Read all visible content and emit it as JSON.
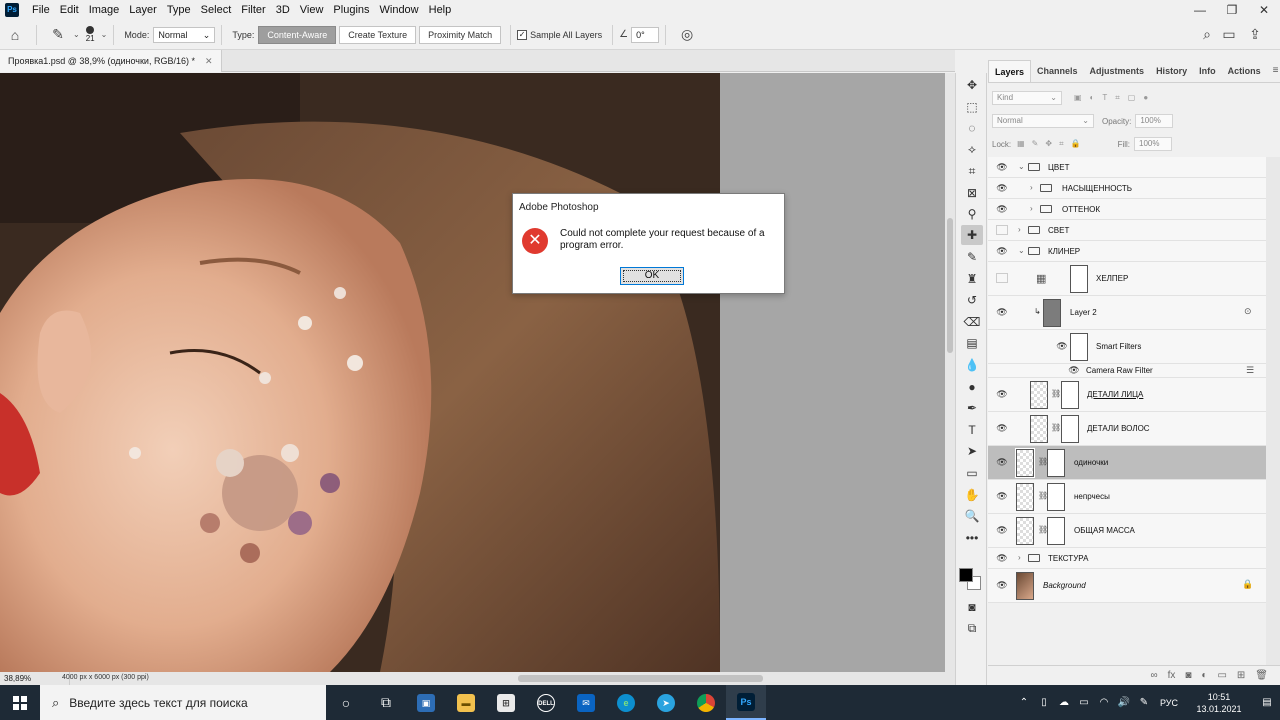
{
  "app": {
    "logo_text": "Ps",
    "menu": [
      "File",
      "Edit",
      "Image",
      "Layer",
      "Type",
      "Select",
      "Filter",
      "3D",
      "View",
      "Plugins",
      "Window",
      "Help"
    ],
    "window_controls": [
      "—",
      "❐",
      "✕"
    ]
  },
  "options_bar": {
    "brush_size": "21",
    "mode_label": "Mode:",
    "mode_value": "Normal",
    "type_label": "Type:",
    "type_buttons": [
      "Content-Aware",
      "Create Texture",
      "Proximity Match"
    ],
    "sample_all_layers": "Sample All Layers",
    "angle_value": "0°"
  },
  "document": {
    "tab_title": "Проявка1.psd @ 38,9% (одиночки, RGB/16) *",
    "zoom": "38,89%",
    "doc_info": "4000 px x 6000 px (300 ppi)"
  },
  "panel": {
    "tabs": [
      "Layers",
      "Channels",
      "Adjustments",
      "History",
      "Info",
      "Actions"
    ],
    "kind_placeholder": "Kind",
    "blend_mode": "Normal",
    "opacity_label": "Opacity:",
    "opacity_value": "100%",
    "lock_label": "Lock:",
    "fill_label": "Fill:",
    "fill_value": "100%"
  },
  "layers": [
    {
      "name": "ЦВЕТ",
      "type": "group",
      "visible": true
    },
    {
      "name": "НАСЫЩЕННОСТЬ",
      "type": "group",
      "visible": true
    },
    {
      "name": "ОТТЕНОК",
      "type": "group",
      "visible": true
    },
    {
      "name": "СВЕТ",
      "type": "group",
      "visible": false
    },
    {
      "name": "КЛИНЕР",
      "type": "group",
      "visible": true
    },
    {
      "name": "ХЕЛПЕР",
      "type": "adjustment",
      "visible": false
    },
    {
      "name": "Layer 2",
      "type": "smart-object",
      "visible": true
    },
    {
      "name": "Smart Filters",
      "type": "smart-filters",
      "visible": true
    },
    {
      "name": "Camera Raw Filter",
      "type": "filter",
      "visible": true
    },
    {
      "name": "ДЕТАЛИ ЛИЦА",
      "type": "masked",
      "visible": true
    },
    {
      "name": "ДЕТАЛИ ВОЛОС",
      "type": "masked",
      "visible": true
    },
    {
      "name": "одиночки",
      "type": "masked",
      "visible": true,
      "selected": true
    },
    {
      "name": "непрчесы",
      "type": "masked",
      "visible": true
    },
    {
      "name": "ОБЩАЯ МАССА",
      "type": "masked",
      "visible": true
    },
    {
      "name": "ТЕКСТУРА",
      "type": "group",
      "visible": true
    },
    {
      "name": "Background",
      "type": "background",
      "visible": true
    }
  ],
  "dialog": {
    "title": "Adobe Photoshop",
    "message": "Could not complete your request because of a program error.",
    "ok_label": "OK"
  },
  "taskbar": {
    "search_placeholder": "Введите здесь текст для поиска",
    "language": "РУС",
    "time": "10:51",
    "date": "13.01.2021"
  }
}
